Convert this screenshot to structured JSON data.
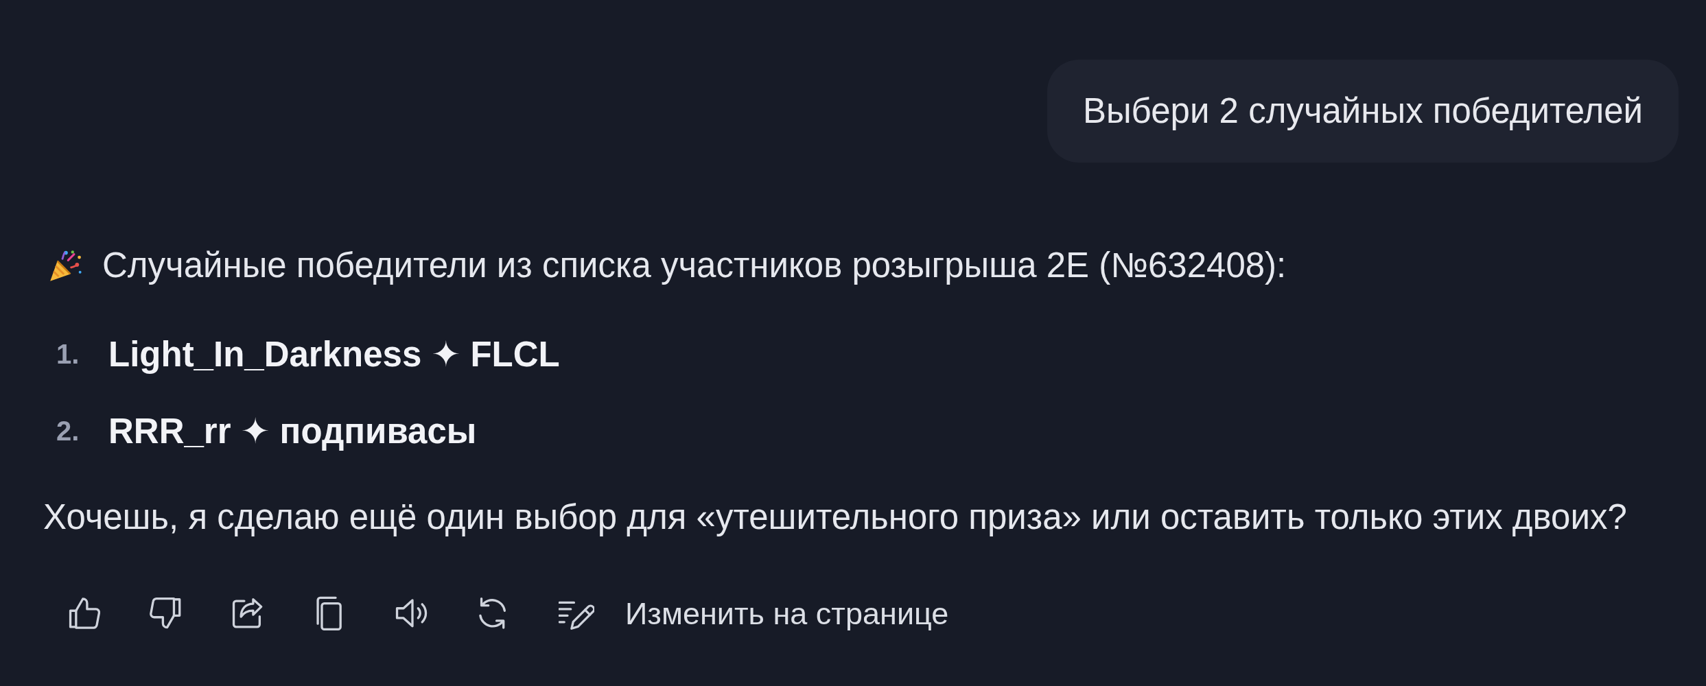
{
  "user_message": {
    "text": "Выбери 2 случайных победителей"
  },
  "assistant_message": {
    "intro": "Случайные победители из списка участников розыгрыша 2E (№632408):",
    "winners": [
      {
        "number": "1.",
        "name": "Light_In_Darkness ✦ FLCL"
      },
      {
        "number": "2.",
        "name": "RRR_rr ✦ подпивасы"
      }
    ],
    "question": "Хочешь, я сделаю ещё один выбор для «утешительного приза» или оставить только этих двоих?"
  },
  "actions": [
    {
      "kind": "like"
    },
    {
      "kind": "dislike"
    },
    {
      "kind": "share"
    },
    {
      "kind": "copy"
    },
    {
      "kind": "speak"
    },
    {
      "kind": "regenerate"
    },
    {
      "kind": "edit",
      "label": "Изменить на странице"
    }
  ]
}
